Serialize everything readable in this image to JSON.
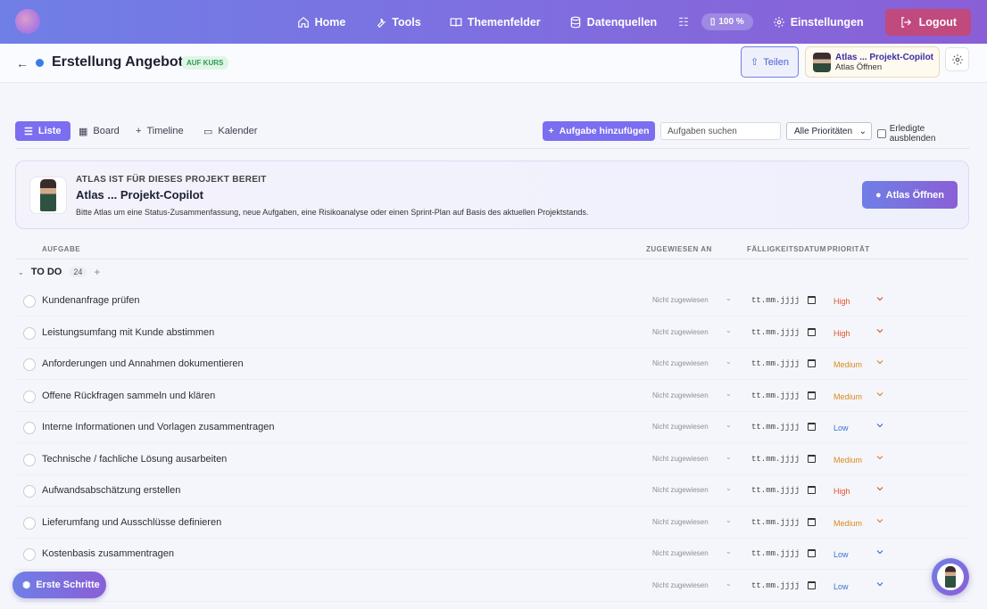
{
  "nav": {
    "items": [
      {
        "label": "Home",
        "icon": "home-icon"
      },
      {
        "label": "Tools",
        "icon": "wrench-icon"
      },
      {
        "label": "Themenfelder",
        "icon": "book-icon"
      },
      {
        "label": "Datenquellen",
        "icon": "database-icon"
      }
    ],
    "zoom": "100 %",
    "settings_label": "Einstellungen",
    "logout_label": "Logout"
  },
  "project": {
    "back_glyph": "←",
    "title": "Erstellung Angebot",
    "status": "AUF KURS",
    "share_label": "Teilen",
    "copilot_title": "Atlas ... Projekt-Copilot",
    "copilot_sub": "Atlas Öffnen"
  },
  "toolbar": {
    "views": [
      {
        "label": "Liste",
        "glyph": "☰"
      },
      {
        "label": "Board",
        "glyph": "▦"
      },
      {
        "label": "Timeline",
        "glyph": "+"
      },
      {
        "label": "Kalender",
        "glyph": "▭"
      }
    ],
    "add_task_label": "Aufgabe hinzufügen",
    "search_placeholder": "Aufgaben suchen",
    "priority_filter": "Alle Prioritäten",
    "hide_done_label": "Erledigte ausblenden"
  },
  "atlas": {
    "kicker": "ATLAS IST FÜR DIESES PROJEKT BEREIT",
    "title": "Atlas ... Projekt-Copilot",
    "description": "Bitte Atlas um eine Status-Zusammenfassung, neue Aufgaben, eine Risikoanalyse oder einen Sprint-Plan auf Basis des aktuellen Projektstands.",
    "open_label": "Atlas Öffnen"
  },
  "table": {
    "columns": {
      "task": "AUFGABE",
      "assignee": "ZUGEWIESEN AN",
      "due": "FÄLLIGKEITSDATUM",
      "priority": "PRIORITÄT"
    },
    "group": {
      "title": "TO DO",
      "count": "24",
      "add_glyph": "+"
    },
    "date_placeholder": "tt.mm.jjjj",
    "assignee_placeholder": "Nicht zugewiesen",
    "rows": [
      {
        "name": "Kundenanfrage prüfen",
        "priority": "High"
      },
      {
        "name": "Leistungsumfang mit Kunde abstimmen",
        "priority": "High"
      },
      {
        "name": "Anforderungen und Annahmen dokumentieren",
        "priority": "Medium"
      },
      {
        "name": "Offene Rückfragen sammeln und klären",
        "priority": "Medium"
      },
      {
        "name": "Interne Informationen und Vorlagen zusammentragen",
        "priority": "Low"
      },
      {
        "name": "Technische / fachliche Lösung ausarbeiten",
        "priority": "Medium"
      },
      {
        "name": "Aufwandsabschätzung erstellen",
        "priority": "High"
      },
      {
        "name": "Lieferumfang und Ausschlüsse definieren",
        "priority": "Medium"
      },
      {
        "name": "Kostenbasis zusammentragen",
        "priority": "Low"
      },
      {
        "name": "…stlegen",
        "priority": "Low"
      }
    ]
  },
  "priority_colors": {
    "High": "#e0542e",
    "Medium": "#d98a1c",
    "Low": "#3b6fd6"
  },
  "floating": {
    "onboarding_label": "Erste Schritte"
  }
}
